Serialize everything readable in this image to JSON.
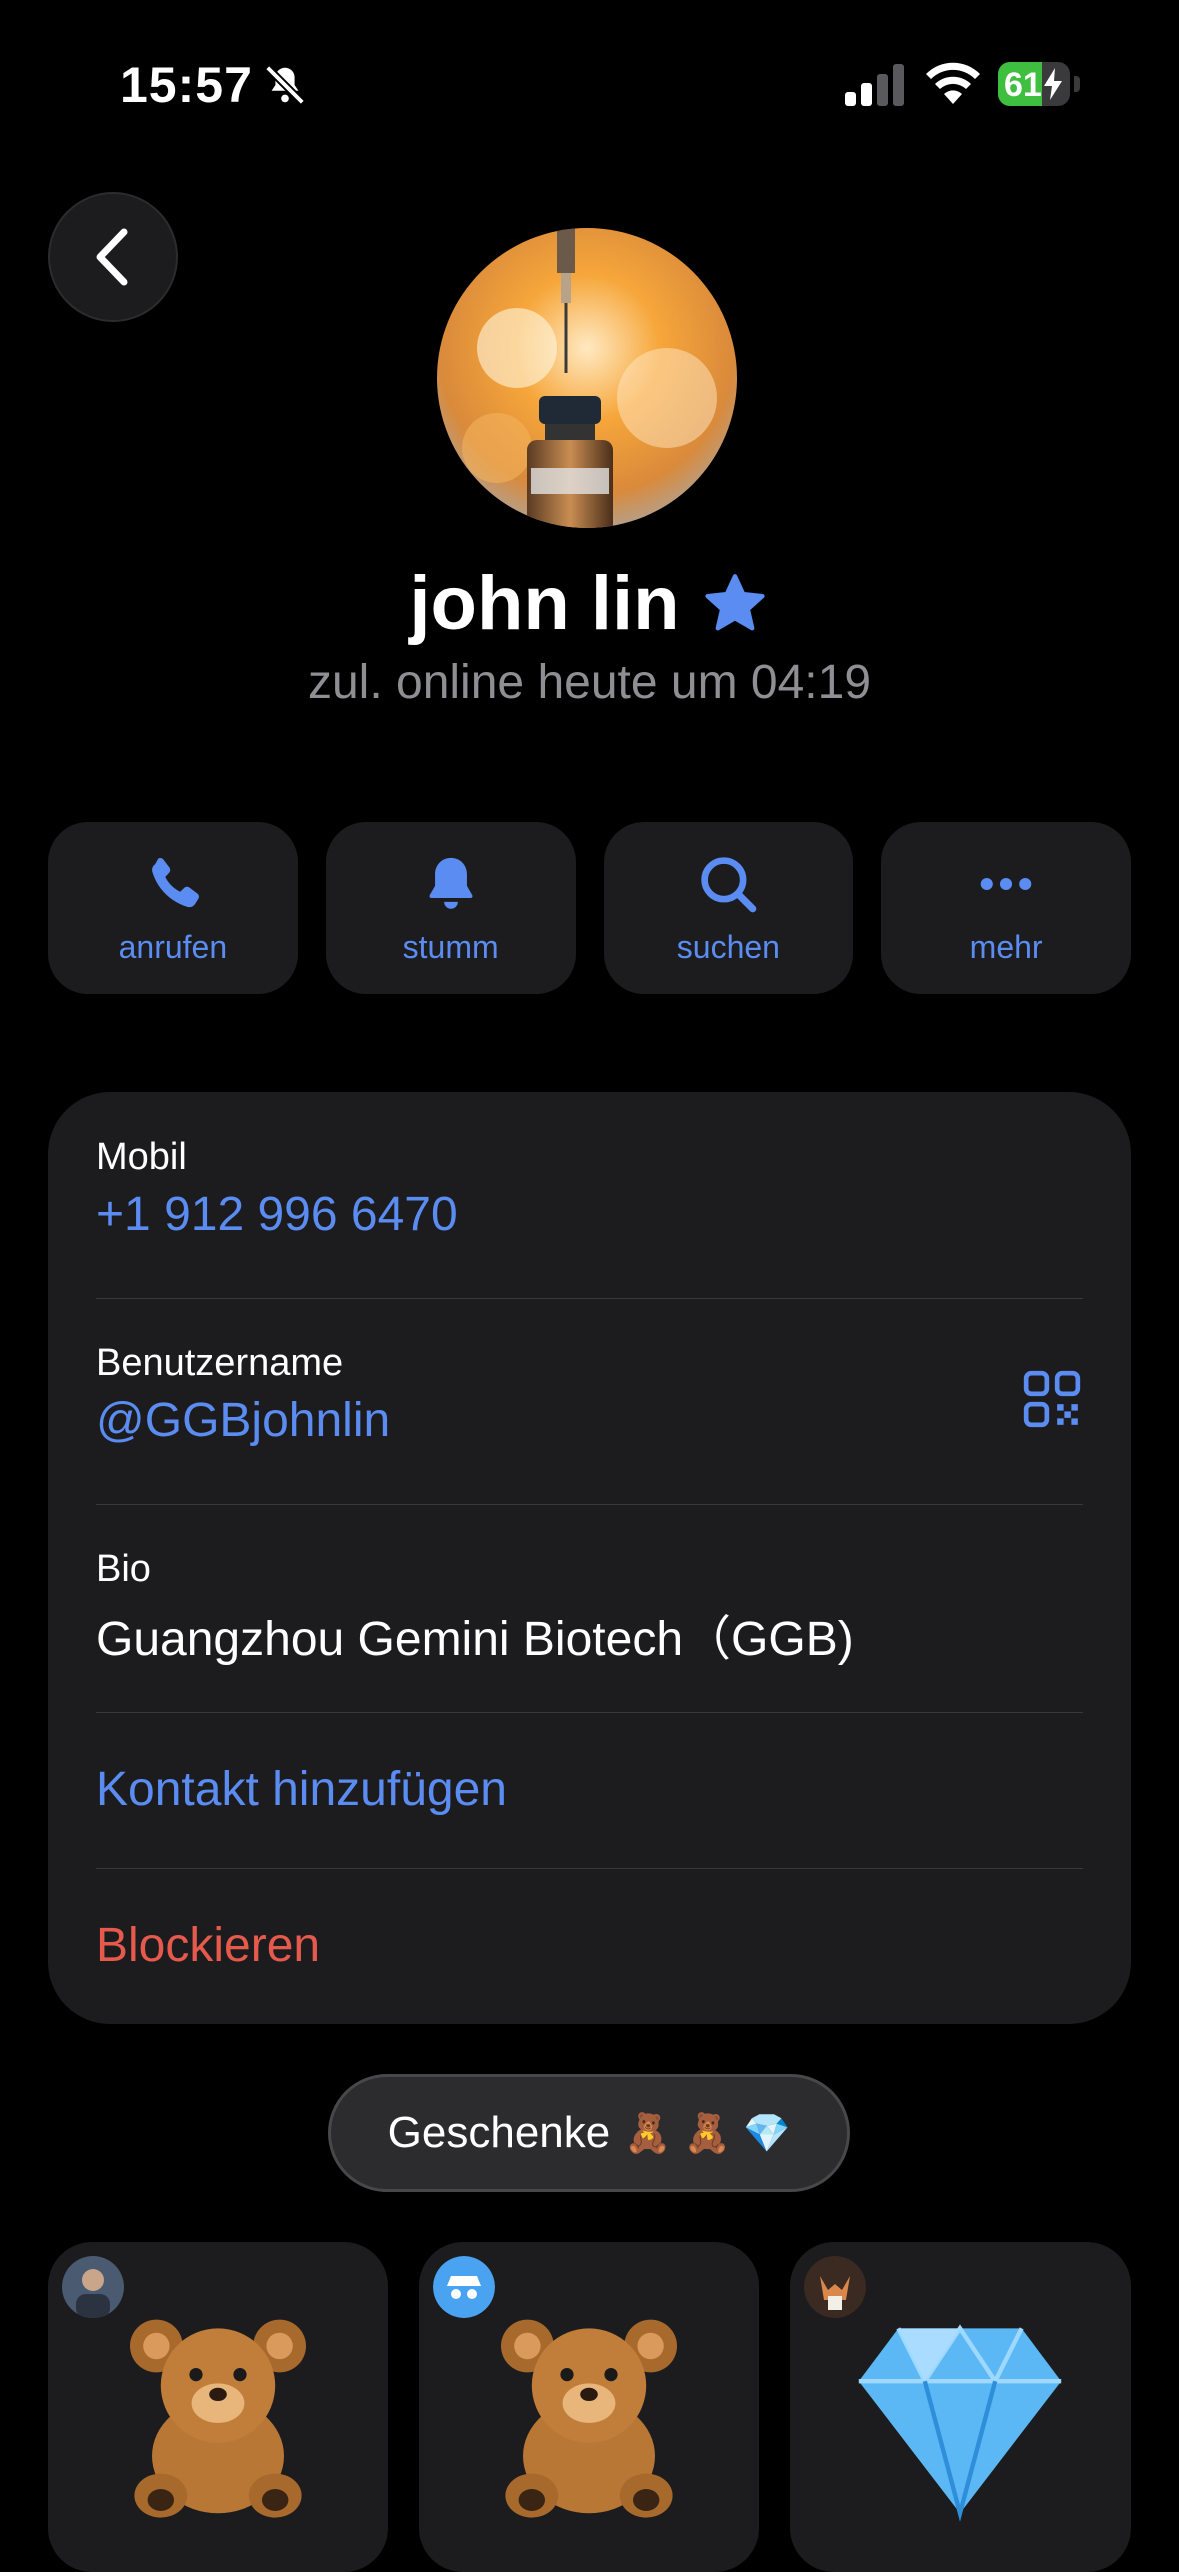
{
  "status_bar": {
    "time": "15:57",
    "battery": "61",
    "battery_level": 0.61
  },
  "profile": {
    "name": "john lin",
    "last_seen": "zul. online heute um 04:19"
  },
  "actions": [
    {
      "label": "anrufen",
      "icon": "phone-icon"
    },
    {
      "label": "stumm",
      "icon": "bell-icon"
    },
    {
      "label": "suchen",
      "icon": "search-icon"
    },
    {
      "label": "mehr",
      "icon": "more-icon"
    }
  ],
  "info": {
    "mobile_label": "Mobil",
    "mobile_value": "+1 912 996 6470",
    "username_label": "Benutzername",
    "username_value": "@GGBjohnlin",
    "bio_label": "Bio",
    "bio_value": "Guangzhou Gemini Biotech（GGB)",
    "add_contact": "Kontakt hinzufügen",
    "block": "Blockieren"
  },
  "gifts": {
    "label": "Geschenke",
    "emojis": "🧸 🧸 💎",
    "items": [
      {
        "kind": "teddy-bear",
        "badge": "user-photo"
      },
      {
        "kind": "teddy-bear",
        "badge": "spy-icon"
      },
      {
        "kind": "diamond",
        "badge": "fox-avatar"
      }
    ]
  },
  "colors": {
    "accent": "#5b8cf1",
    "destructive": "#e65a4d",
    "card": "#1c1c1e",
    "background": "#000000"
  }
}
